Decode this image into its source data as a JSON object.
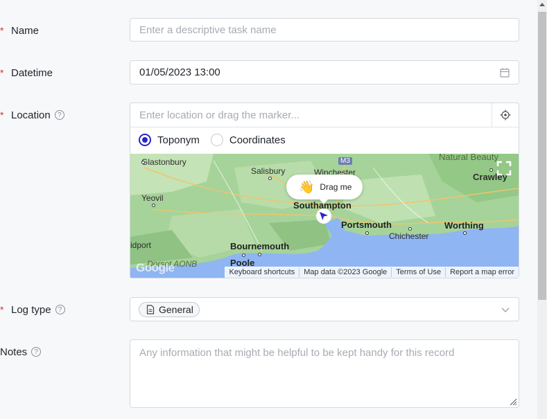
{
  "fields": {
    "name": {
      "label": "Name",
      "required": "*",
      "placeholder": "Enter a descriptive task name",
      "value": ""
    },
    "datetime": {
      "label": "Datetime",
      "required": "*",
      "value": "01/05/2023 13:00"
    },
    "location": {
      "label": "Location",
      "required": "*",
      "help": "?",
      "placeholder": "Enter location or drag the marker...",
      "modes": [
        "Toponym",
        "Coordinates"
      ],
      "selected_mode": "Toponym"
    },
    "log_type": {
      "label": "Log type",
      "required": "*",
      "help": "?",
      "chip": "General"
    },
    "notes": {
      "label": "Notes",
      "help": "?",
      "placeholder": "Any information that might be helpful to be kept handy for this record"
    }
  },
  "map": {
    "tooltip": "Drag me",
    "places": {
      "glastonbury": "Glastonbury",
      "salisbury": "Salisbury",
      "winchester": "Winchester",
      "m3": "M3",
      "natural_beauty": "Natural Beauty",
      "crawley": "Crawley",
      "yeovil": "Yeovil",
      "southampton": "Southampton",
      "portsmouth": "Portsmouth",
      "worthing": "Worthing",
      "chichester": "Chichester",
      "bridport": "idport",
      "bournemouth": "Bournemouth",
      "poole": "Poole",
      "dorset": "Dorset AONB"
    },
    "logo": "Google",
    "footer": [
      "Keyboard shortcuts",
      "Map data ©2023 Google",
      "Terms of Use",
      "Report a map error"
    ]
  },
  "colors": {
    "accent": "#2a24c8",
    "required": "#d6332f",
    "border": "#d5d8dd",
    "sea": "#8fb5f2",
    "land": "#a6d39a"
  }
}
